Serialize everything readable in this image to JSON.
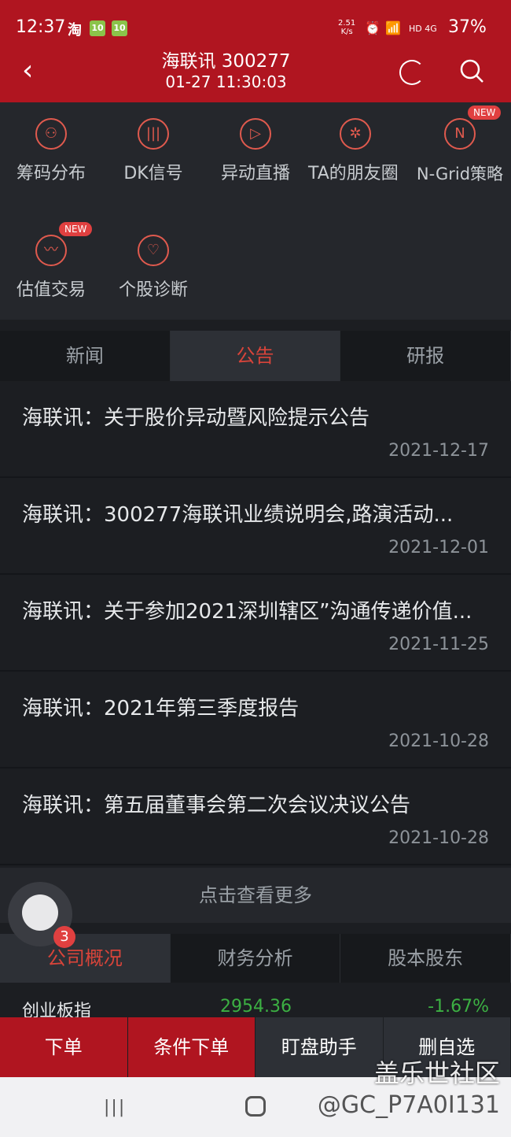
{
  "status_bar": {
    "time": "12:37",
    "app_taobao": "淘",
    "badge_1": "10",
    "badge_2": "10",
    "speed": "2.51",
    "speed_unit": "K/s",
    "network": "HD 4G",
    "battery": "37%"
  },
  "header": {
    "title": "海联讯 300277",
    "datetime": "01-27 11:30:03"
  },
  "tools": [
    {
      "label": "筹码分布",
      "icon": "chips-icon",
      "new": false
    },
    {
      "label": "DK信号",
      "icon": "signal-icon",
      "new": false
    },
    {
      "label": "异动直播",
      "icon": "play-icon",
      "new": false
    },
    {
      "label": "TA的朋友圈",
      "icon": "friends-icon",
      "new": false
    },
    {
      "label": "N-Grid策略",
      "icon": "ngrid-icon",
      "new": true
    },
    {
      "label": "估值交易",
      "icon": "valuation-icon",
      "new": true
    },
    {
      "label": "个股诊断",
      "icon": "diagnosis-icon",
      "new": false
    }
  ],
  "new_badge": "NEW",
  "tabs": [
    {
      "label": "新闻",
      "active": false
    },
    {
      "label": "公告",
      "active": true
    },
    {
      "label": "研报",
      "active": false
    }
  ],
  "announcements": [
    {
      "title": "海联讯：关于股价异动暨风险提示公告",
      "date": "2021-12-17"
    },
    {
      "title": "海联讯：300277海联讯业绩说明会,路演活动...",
      "date": "2021-12-01"
    },
    {
      "title": "海联讯：关于参加2021深圳辖区”沟通传递价值...",
      "date": "2021-11-25"
    },
    {
      "title": "海联讯：2021年第三季度报告",
      "date": "2021-10-28"
    },
    {
      "title": "海联讯：第五届董事会第二次会议决议公告",
      "date": "2021-10-28"
    }
  ],
  "more_label": "点击查看更多",
  "tabs2": [
    {
      "label": "公司概况",
      "active": true
    },
    {
      "label": "财务分析",
      "active": false
    },
    {
      "label": "股本股东",
      "active": false
    }
  ],
  "assistant_badge": "3",
  "ticker": {
    "name": "创业板指",
    "value": "2954.36",
    "change": "-1.67%"
  },
  "actions": [
    {
      "label": "下单",
      "style": "red"
    },
    {
      "label": "条件下单",
      "style": "red"
    },
    {
      "label": "盯盘助手",
      "style": "dark"
    },
    {
      "label": "删自选",
      "style": "dark"
    }
  ],
  "watermark": {
    "site": "盖乐世社区",
    "user": "@GC_P7A0I131"
  },
  "colors": {
    "brand_red": "#b01520",
    "active_tab_text": "#d8443a",
    "down_green": "#3cb043"
  }
}
